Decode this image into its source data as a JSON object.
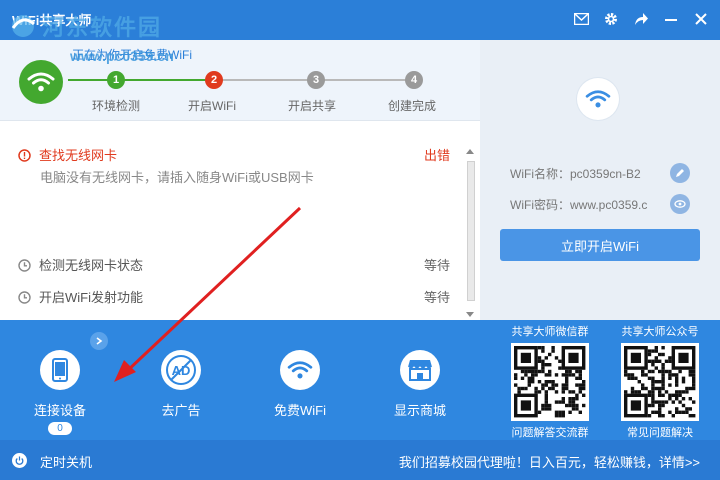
{
  "titlebar": {
    "title": "WiFi共享大师"
  },
  "watermark": {
    "text": "河东软件园",
    "url": "www.pc0359.cn"
  },
  "steps": {
    "header": "正在为你开启免费WiFi",
    "items": [
      {
        "num": "1",
        "label": "环境检测",
        "state": "done",
        "color": "#43a82f"
      },
      {
        "num": "2",
        "label": "开启WiFi",
        "state": "active",
        "color": "#e03a1e"
      },
      {
        "num": "3",
        "label": "开启共享",
        "state": "pending",
        "color": "#9a9a9a"
      },
      {
        "num": "4",
        "label": "创建完成",
        "state": "pending",
        "color": "#9a9a9a"
      }
    ]
  },
  "tasks": [
    {
      "title": "查找无线网卡",
      "status": "出错",
      "sub": "电脑没有无线网卡，请插入随身WiFi或USB网卡",
      "icon": "alert-icon"
    },
    {
      "title": "检测无线网卡状态",
      "status": "等待",
      "icon": "clock-icon"
    },
    {
      "title": "开启WiFi发射功能",
      "status": "等待",
      "icon": "clock-icon"
    }
  ],
  "wifi_info": {
    "name_label": "WiFi名称：",
    "name_value": "pc0359cn-B2",
    "pwd_label": "WiFi密码：",
    "pwd_value": "www.pc0359.c",
    "start_button": "立即开启WiFi"
  },
  "tools": [
    {
      "label": "连接设备",
      "count": "0",
      "icon": "phone-icon"
    },
    {
      "label": "去广告",
      "icon": "no-ad-icon"
    },
    {
      "label": "免费WiFi",
      "icon": "wifi-icon"
    },
    {
      "label": "显示商城",
      "icon": "store-icon"
    }
  ],
  "qr": {
    "wechat_group_title": "共享大师微信群",
    "wechat_group_caption": "问题解答交流群",
    "public_title": "共享大师公众号",
    "public_caption": "常见问题解决"
  },
  "footer": {
    "shutdown_label": "定时关机",
    "promo": "我们招募校园代理啦！日入百元，轻松赚钱，详情>>"
  },
  "colors": {
    "brand_blue": "#2b7fd8",
    "error_red": "#e03a1e",
    "ok_green": "#43a82f"
  }
}
